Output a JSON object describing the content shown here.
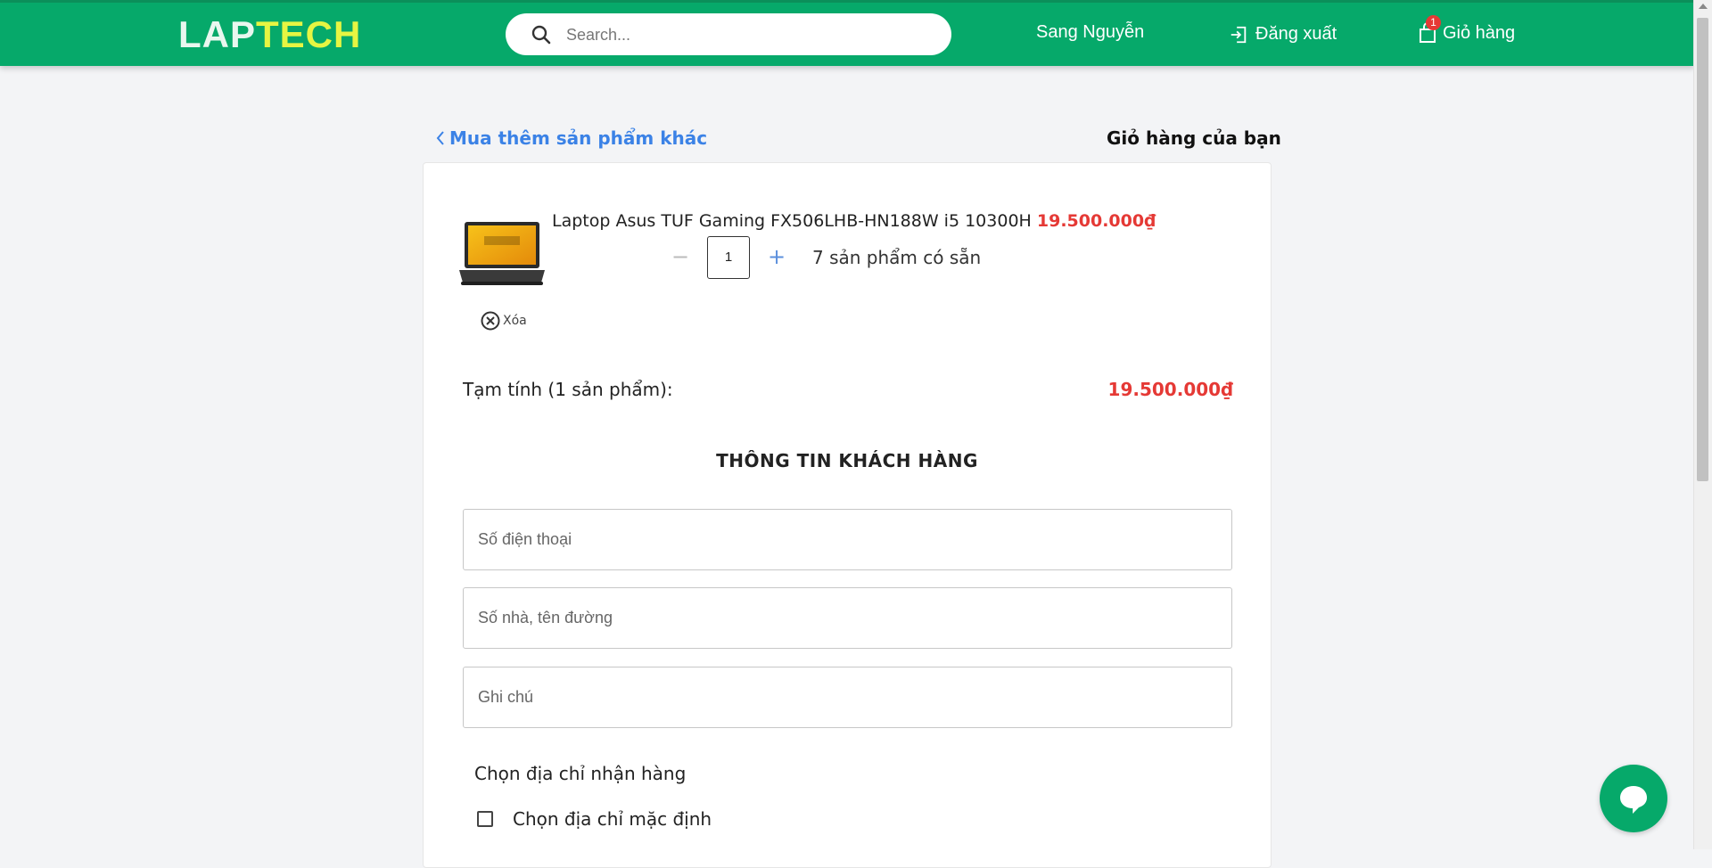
{
  "brand": {
    "part1": "LAP",
    "part2": "TECH",
    "color_primary": "#06a96a",
    "color_accent": "#e6f542"
  },
  "search": {
    "placeholder": "Search..."
  },
  "nav": {
    "user_name": "Sang Nguyễn",
    "logout_label": "Đăng xuất",
    "cart_label": "Giỏ hàng",
    "cart_count": "1"
  },
  "page": {
    "back_label": "Mua thêm sản phẩm khác",
    "title": "Giỏ hàng của bạn"
  },
  "cart_items": [
    {
      "name": "Laptop Asus TUF Gaming FX506LHB-HN188W i5 10300H",
      "price": "19.500.000₫",
      "quantity": "1",
      "availability": "7 sản phẩm có sẵn",
      "remove_label": "Xóa"
    }
  ],
  "summary": {
    "subtotal_label": "Tạm tính (1 sản phẩm):",
    "subtotal_value": "19.500.000₫"
  },
  "customer": {
    "section_title": "THÔNG TIN KHÁCH HÀNG",
    "phone_placeholder": "Số điện thoại",
    "address_placeholder": "Số nhà, tên đường",
    "note_placeholder": "Ghi chú",
    "address_choice_label": "Chọn địa chỉ nhận hàng",
    "default_address_label": "Chọn địa chỉ mặc định"
  },
  "icons": [
    "search-icon",
    "logout-icon",
    "shopping-bag-icon",
    "chevron-left-icon",
    "close-circle-icon",
    "chat-icon"
  ]
}
